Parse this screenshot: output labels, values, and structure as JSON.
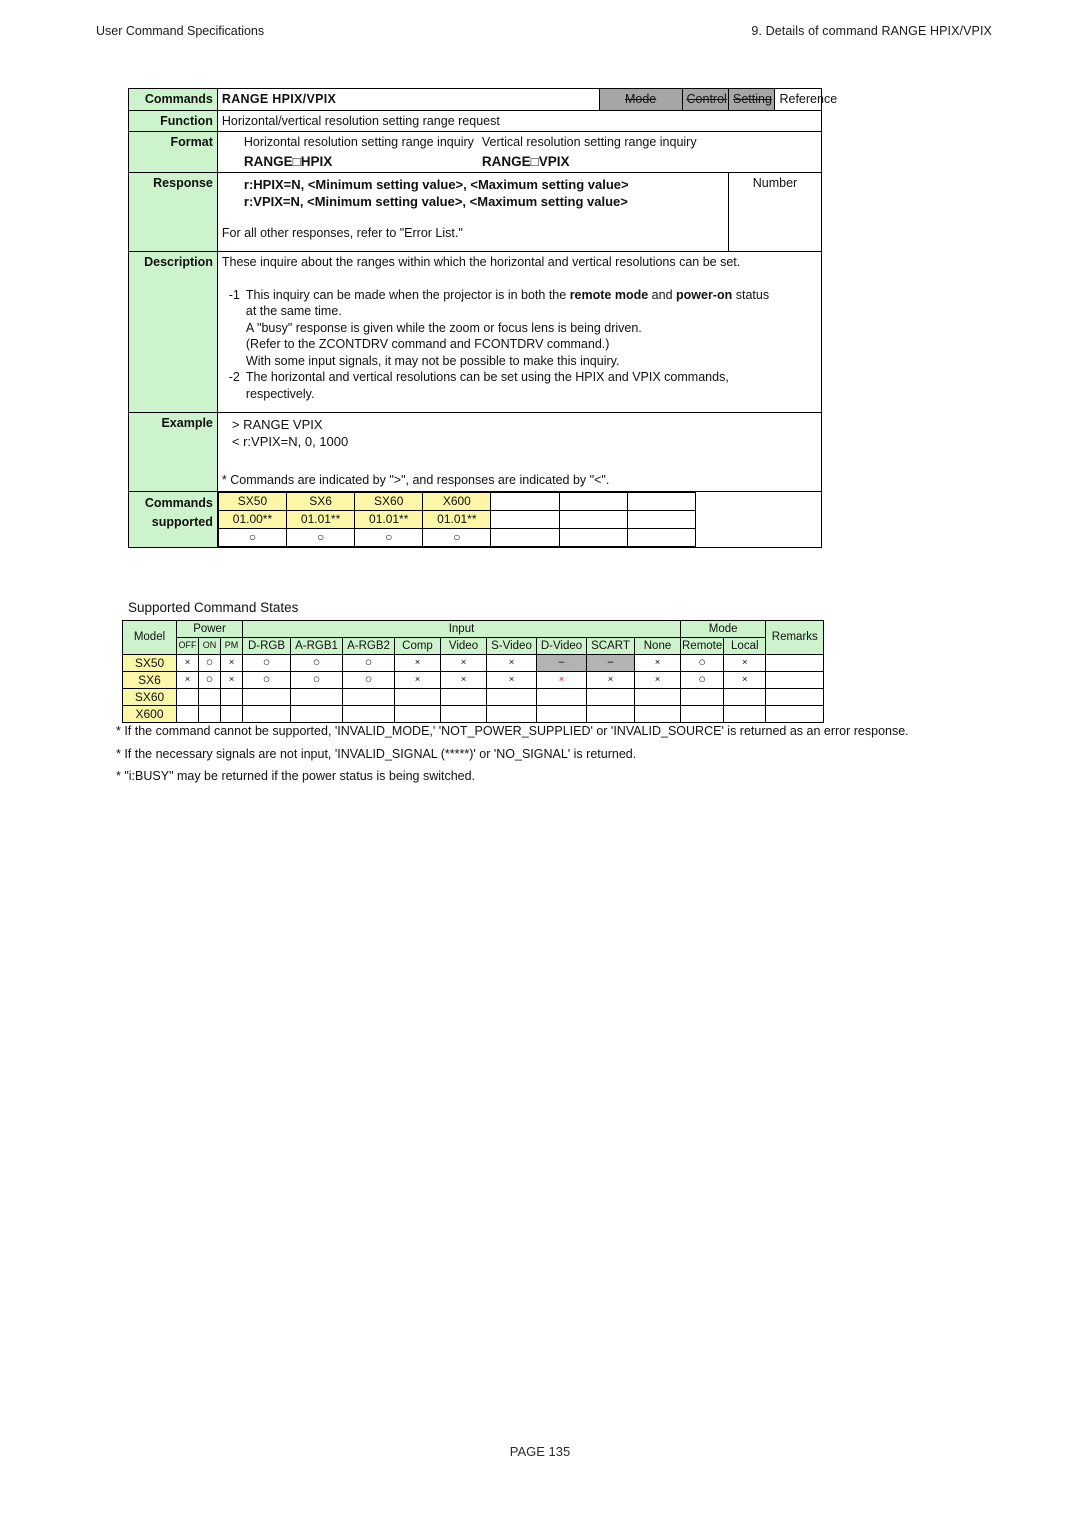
{
  "header": {
    "left": "User Command Specifications",
    "right": "9. Details of command  RANGE HPIX/VPIX"
  },
  "command": {
    "label_commands": "Commands",
    "title": "RANGE HPIX/VPIX",
    "attributes": [
      {
        "label": "Mode",
        "enabled": false
      },
      {
        "label": "Control",
        "enabled": false
      },
      {
        "label": "Setting",
        "enabled": false
      },
      {
        "label": "Reference",
        "enabled": true
      }
    ],
    "function": {
      "label": "Function",
      "text": "Horizontal/vertical resolution setting range request"
    },
    "format": {
      "label": "Format",
      "caption_h": "Horizontal resolution setting range inquiry",
      "caption_v": "Vertical resolution setting range inquiry",
      "syntax_h": "RANGE□HPIX",
      "syntax_v": "RANGE□VPIX"
    },
    "response": {
      "label": "Response",
      "line1": "r:HPIX=N, <Minimum setting value>, <Maximum setting value>",
      "line2": "r:VPIX=N, <Minimum setting value>, <Maximum setting value>",
      "line3": "For all other responses, refer to \"Error List.\"",
      "type": "Number"
    },
    "description": {
      "label": "Description",
      "intro": "These inquire about the ranges within which the horizontal and vertical resolutions can be set.",
      "items": [
        {
          "num": "-1",
          "line1_a": "This inquiry can be made when the projector is in both the ",
          "line1_b": "remote mode",
          "line1_c": " and ",
          "line1_d": "power-on",
          "line1_e": " status",
          "line2": "at the same time.",
          "line3": "A \"busy\" response is given while the zoom or focus lens is being driven.",
          "line4": "(Refer to the ZCONTDRV command and FCONTDRV command.)",
          "line5": "With some input signals, it may not be possible to make this inquiry."
        },
        {
          "num": "-2",
          "line1": "The horizontal and vertical resolutions can be set using the HPIX and VPIX commands,",
          "line2": "respectively."
        }
      ]
    },
    "example": {
      "label": "Example",
      "line1": "> RANGE VPIX",
      "line2": "< r:VPIX=N, 0, 1000",
      "note": "* Commands are indicated by \">\", and responses are indicated by \"<\"."
    },
    "supported": {
      "label_line1": "Commands",
      "label_line2": "supported",
      "models": [
        {
          "name": "SX50",
          "version": "01.00**",
          "state": "○"
        },
        {
          "name": "SX6",
          "version": "01.01**",
          "state": "○"
        },
        {
          "name": "SX60",
          "version": "01.01**",
          "state": "○"
        },
        {
          "name": "X600",
          "version": "01.01**",
          "state": "○"
        },
        {
          "name": "",
          "version": "",
          "state": ""
        },
        {
          "name": "",
          "version": "",
          "state": ""
        },
        {
          "name": "",
          "version": "",
          "state": ""
        }
      ]
    }
  },
  "states": {
    "title": "Supported Command States",
    "group_headers": {
      "model": "Model",
      "power": "Power",
      "input": "Input",
      "mode": "Mode",
      "remarks": "Remarks"
    },
    "sub_headers": {
      "power": [
        "OFF",
        "ON",
        "PM"
      ],
      "input": [
        "D-RGB",
        "A-RGB1",
        "A-RGB2",
        "Comp",
        "Video",
        "S-Video",
        "D-Video",
        "SCART",
        "None"
      ],
      "mode": [
        "Remote",
        "Local"
      ]
    },
    "rows": [
      {
        "models": [
          "SX50"
        ],
        "power": [
          "×",
          "○",
          "×"
        ],
        "input": [
          "○",
          "○",
          "○",
          "×",
          "×",
          "×",
          "−",
          "−",
          "×"
        ],
        "input_style": [
          "x",
          "x",
          "x",
          "x",
          "x",
          "x",
          "gray",
          "gray",
          "x"
        ],
        "mode": [
          "○",
          "×"
        ],
        "remarks": ""
      },
      {
        "models": [
          "SX6",
          "SX60",
          "X600"
        ],
        "power": [
          "×",
          "○",
          "×"
        ],
        "input": [
          "○",
          "○",
          "○",
          "×",
          "×",
          "×",
          "×",
          "×",
          "×"
        ],
        "input_style": [
          "x",
          "x",
          "x",
          "x",
          "x",
          "x",
          "red",
          "x",
          "x"
        ],
        "mode": [
          "○",
          "×"
        ],
        "remarks": ""
      }
    ]
  },
  "footnotes": [
    "* If the command cannot be supported, 'INVALID_MODE,' 'NOT_POWER_SUPPLIED' or 'INVALID_SOURCE' is returned as an error response.",
    "* If the necessary signals are not input, 'INVALID_SIGNAL (*****)' or 'NO_SIGNAL' is returned.",
    "* \"i:BUSY\" may be returned if the power status is being switched."
  ],
  "footer": {
    "page": "PAGE 135"
  }
}
